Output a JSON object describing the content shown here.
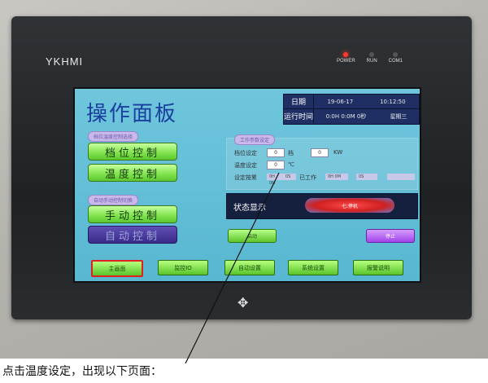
{
  "device": {
    "brand": "YKHMI",
    "leds": [
      {
        "label": "POWER",
        "on": true
      },
      {
        "label": "RUN",
        "on": false
      },
      {
        "label": "COM1",
        "on": false
      }
    ],
    "nav_key_glyph": "✥"
  },
  "screen": {
    "title": "操作面板",
    "info": {
      "date_label": "日期",
      "date_value": "19-06-17",
      "time_value": "10:12:50",
      "runtime_label": "运行时间",
      "runtime_value": "0:0H 0:0M 0秒",
      "weekday": "星期三"
    },
    "group1": {
      "label": "档位温度控制选择",
      "btn1": "档位控制",
      "btn2": "温度控制"
    },
    "group2": {
      "label": "自动手动控制切换",
      "btn1": "手动控制",
      "btn2": "自动控制"
    },
    "params": {
      "label": "工作参数设定",
      "gear_label": "档位设定",
      "gear_value": "0",
      "gear_unit": "档",
      "gear_value2": "0",
      "gear_unit2": "KW",
      "temp_label": "温度设定",
      "temp_value": "0",
      "temp_unit": "℃",
      "time_label": "设定按累",
      "time_text": "已工作",
      "time_box1": "0H 0M",
      "time_box2": "0S",
      "time_box3": "0H 0M",
      "time_box4": "0S"
    },
    "status": {
      "label": "状态显示",
      "pill_text": "七.停机"
    },
    "start_btn": "启动",
    "stop_btn": "停止",
    "nav": [
      {
        "label": "主画面",
        "active": true
      },
      {
        "label": "监控IO",
        "active": false
      },
      {
        "label": "自动设置",
        "active": false
      },
      {
        "label": "系统设置",
        "active": false
      },
      {
        "label": "报警说明",
        "active": false
      }
    ]
  },
  "caption": "点击温度设定，出现以下页面："
}
